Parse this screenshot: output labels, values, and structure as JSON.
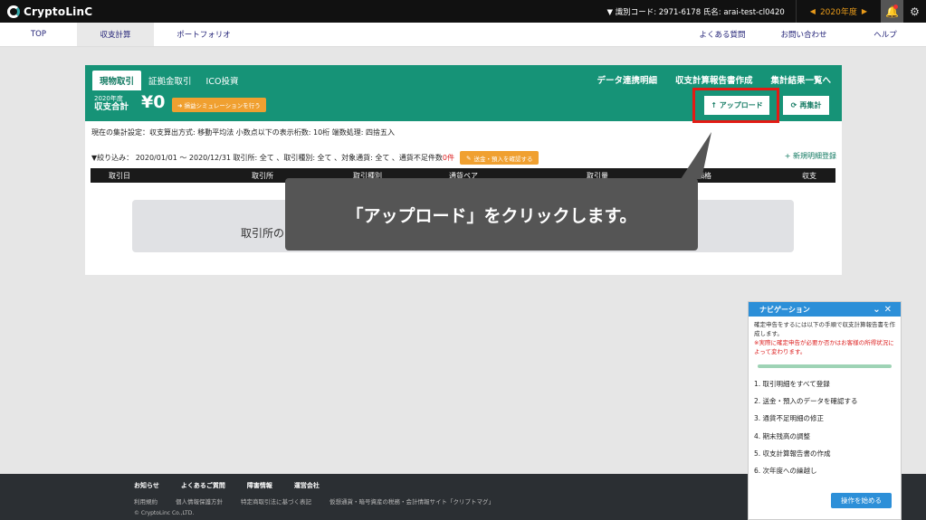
{
  "topbar": {
    "logo": "CryptoLinC",
    "account": "▼ 識別コード: 2971-6178  氏名: arai-test-cl0420",
    "year": "2020年度",
    "prev_icon": "triangle-left",
    "next_icon": "triangle-right",
    "bell_icon": "bell",
    "settings_icon": "gear"
  },
  "nav": {
    "items": [
      "TOP",
      "収支計算",
      "ポートフォリオ"
    ],
    "right_items": [
      "よくある質問",
      "お問い合わせ",
      "ヘルプ"
    ]
  },
  "panel": {
    "tabs": [
      "現物取引",
      "証拠金取引",
      "ICO投資"
    ],
    "links": [
      "データ連携明細",
      "収支計算報告書作成",
      "集計結果一覧へ"
    ],
    "year_label": "2020年度",
    "sum_label": "収支合計",
    "amount": "¥0",
    "sim_button": "➜ 損益シミュレーションを行う",
    "upload_button": "↑ アップロード",
    "recalc_button": "再集計",
    "settings_text": "現在の集計設定：収支算出方式: 移動平均法  小数点以下の表示桁数: 10桁  端数処理: 四捨五入",
    "filter_text": "▼絞り込み： 2020/01/01 〜 2020/12/31 取引所: 全て 、取引種別: 全て 、対象通貨: 全て 、通貨不足件数",
    "filter_count": "0件",
    "confirm_button": "送金・預入を確認する",
    "new_link": "+ 新規明細登録",
    "columns": [
      "取引日",
      "取引所",
      "取引種別",
      "通貨ペア",
      "取引量",
      "価格",
      "収支"
    ],
    "empty_text": "取引所の"
  },
  "tooltip": {
    "text": "「アップロード」をクリックします。"
  },
  "footer": {
    "row1": [
      "お知らせ",
      "よくあるご質問",
      "障害情報",
      "運営会社"
    ],
    "row2": [
      "利用規約",
      "個人情報保護方針",
      "特定商取引法に基づく表記",
      "仮想通貨・暗号資産の税務・会計情報サイト「クリプトマグ」"
    ],
    "copyright": "© CryptoLinc Co.,LTD."
  },
  "navigation": {
    "title": "ナビゲーション",
    "desc": "確定申告をするには以下の手順で収支計算報告書を作成します。",
    "warn": "※実際に確定申告が必要か否かはお客様の所得状況によって変わります。",
    "steps": [
      "1. 取引明細をすべて登録",
      "2. 送金・預入のデータを確認する",
      "3. 通貨不足明細の修正",
      "4. 期末残高の調整",
      "5. 収支計算報告書の作成",
      "6. 次年度への繰越し"
    ],
    "start_button": "操作を始める"
  },
  "colors": {
    "brand_green": "#169377",
    "highlight_red": "#e31b14",
    "accent_orange": "#f0a030",
    "navi_blue": "#2c8fd8"
  }
}
